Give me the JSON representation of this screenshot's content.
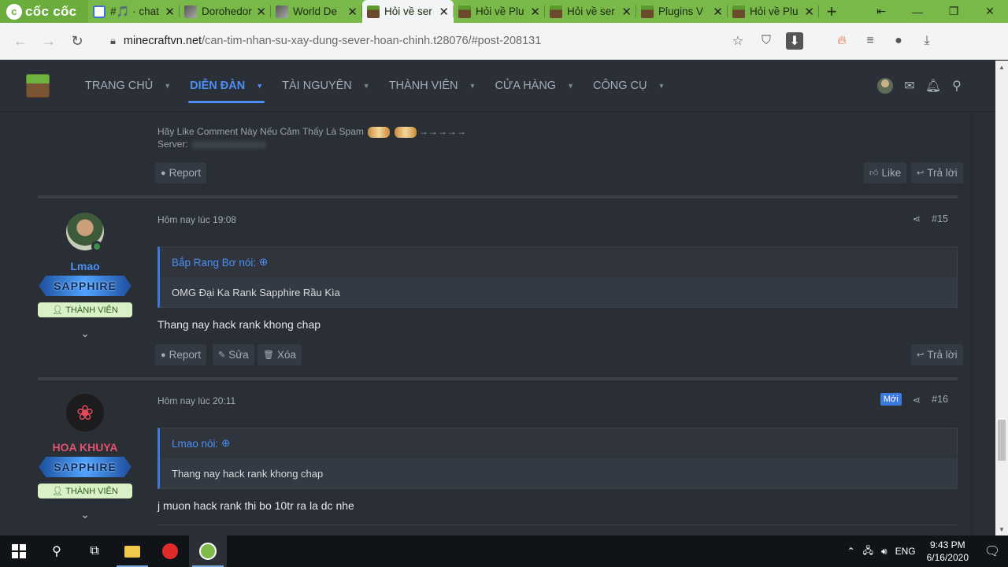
{
  "browser": {
    "brand": "cốc cốc",
    "tabs": [
      {
        "title": "#🎵 · chat",
        "icon": "discord-icon"
      },
      {
        "title": "Dorohedoro",
        "icon": "anime-icon"
      },
      {
        "title": "World De",
        "icon": "anime-icon"
      },
      {
        "title": "Hỏi về ser",
        "icon": "minecraft-icon",
        "active": true
      },
      {
        "title": "Hỏi về Plu",
        "icon": "minecraft-icon"
      },
      {
        "title": "Hỏi về ser",
        "icon": "minecraft-icon"
      },
      {
        "title": "Plugins V",
        "icon": "minecraft-icon"
      },
      {
        "title": "Hỏi về Plu",
        "icon": "minecraft-icon"
      }
    ],
    "url_host": "minecraftvn.net",
    "url_path": "/can-tim-nhan-su-xay-dung-sever-hoan-chinh.t28076/#post-208131"
  },
  "site": {
    "nav": [
      {
        "label": "TRANG CHỦ"
      },
      {
        "label": "DIỄN ĐÀN",
        "active": true
      },
      {
        "label": "TÀI NGUYÊN"
      },
      {
        "label": "THÀNH VIÊN"
      },
      {
        "label": "CỬA HÀNG"
      },
      {
        "label": "CÔNG CỤ"
      }
    ]
  },
  "prev_post": {
    "signature_line": "Hãy Like Comment Này Nếu Cảm Thấy Là Spam",
    "signature_arrows": "→→→→→",
    "server_label": "Server:",
    "report": "Report",
    "like": "Like",
    "reply": "Trả lời"
  },
  "posts": [
    {
      "username": "Lmao",
      "rank": "SAPPHIRE",
      "role": "THÀNH VIÊN",
      "time": "Hôm nay lúc 19:08",
      "number": "#15",
      "quote_author": "Bắp Rang Bơ nói:",
      "quote_text": "OMG Đại Ka Rank Sapphire Rầu Kìa",
      "message": "Thang nay hack rank khong chap",
      "actions": {
        "report": "Report",
        "edit": "Sửa",
        "delete": "Xóa",
        "reply": "Trả lời"
      }
    },
    {
      "username": "HOA KHUYA",
      "rank": "SAPPHIRE",
      "role": "THÀNH VIÊN",
      "time": "Hôm nay lúc 20:11",
      "badge": "Mới",
      "number": "#16",
      "quote_author": "Lmao nói:",
      "quote_text": "Thang nay hack rank khong chap",
      "message": "j muon hack rank thi bo 10tr ra la dc nhe"
    }
  ],
  "taskbar": {
    "language": "ENG",
    "time": "9:43 PM",
    "date": "6/16/2020"
  }
}
